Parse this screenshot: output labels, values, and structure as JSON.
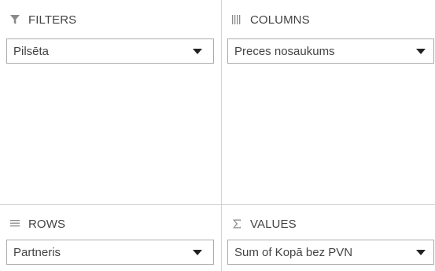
{
  "filters": {
    "header": "FILTERS",
    "icon": "filter-icon",
    "field": "Pilsēta"
  },
  "columns": {
    "header": "COLUMNS",
    "icon": "columns-icon",
    "field": "Preces nosaukums"
  },
  "rows": {
    "header": "ROWS",
    "icon": "rows-icon",
    "field": "Partneris"
  },
  "values": {
    "header": "VALUES",
    "icon": "sigma-icon",
    "field": "Sum of Kopā bez PVN"
  },
  "colors": {
    "text": "#444444",
    "icon": "#8a8a8a",
    "border": "#ababab",
    "divider": "#d4d4d4",
    "arrow": "#222222"
  }
}
